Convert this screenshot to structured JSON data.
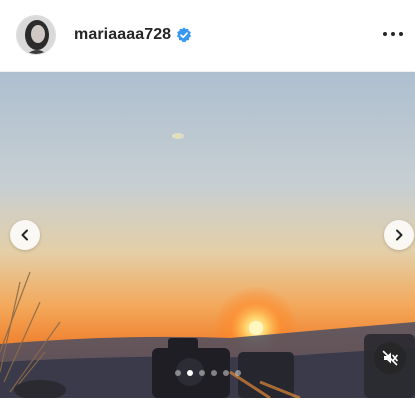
{
  "post": {
    "username": "mariaaaa728",
    "verified": true,
    "avatar_icon": "avatar-portrait",
    "more_icon": "more-horizontal-icon"
  },
  "carousel": {
    "total_slides": 6,
    "active_index": 1,
    "prev_icon": "chevron-left-icon",
    "next_icon": "chevron-right-icon"
  },
  "video": {
    "muted": true,
    "mute_icon": "speaker-muted-icon"
  },
  "colors": {
    "verified_blue": "#3897f0",
    "header_text": "#262626",
    "sky_top": "#b5c7d8",
    "sky_horizon": "#f39a3a",
    "sun": "#fff2a0"
  }
}
